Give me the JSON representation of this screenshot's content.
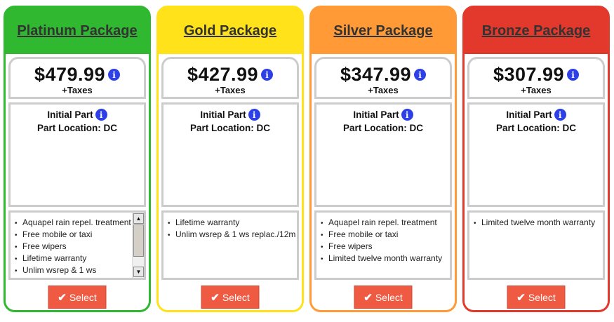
{
  "packages": [
    {
      "title": "Platinum Package",
      "color": "#2fb830",
      "price": "$479.99",
      "taxes": "+Taxes",
      "initial_part": "Initial Part",
      "part_location": "Part Location: DC",
      "features": [
        "Aquapel rain repel. treatment",
        "Free mobile or taxi",
        "Free wipers",
        "Lifetime warranty",
        "Unlim wsrep & 1 ws"
      ],
      "has_scrollbar": true,
      "select_label": "Select"
    },
    {
      "title": "Gold Package",
      "color": "#ffe21a",
      "price": "$427.99",
      "taxes": "+Taxes",
      "initial_part": "Initial Part",
      "part_location": "Part Location: DC",
      "features": [
        "Lifetime warranty",
        "Unlim wsrep & 1 ws replac./12m"
      ],
      "has_scrollbar": false,
      "select_label": "Select"
    },
    {
      "title": "Silver Package",
      "color": "#ff9a36",
      "price": "$347.99",
      "taxes": "+Taxes",
      "initial_part": "Initial Part",
      "part_location": "Part Location: DC",
      "features": [
        "Aquapel rain repel. treatment",
        "Free mobile or taxi",
        "Free wipers",
        "Limited twelve month warranty"
      ],
      "has_scrollbar": false,
      "select_label": "Select"
    },
    {
      "title": "Bronze Package",
      "color": "#e2392c",
      "price": "$307.99",
      "taxes": "+Taxes",
      "initial_part": "Initial Part",
      "part_location": "Part Location: DC",
      "features": [
        "Limited twelve month warranty"
      ],
      "has_scrollbar": false,
      "select_label": "Select"
    }
  ],
  "icons": {
    "info": "info-icon",
    "check": "check-icon",
    "scroll_up": "scroll-up-arrow-icon",
    "scroll_down": "scroll-down-arrow-icon"
  }
}
